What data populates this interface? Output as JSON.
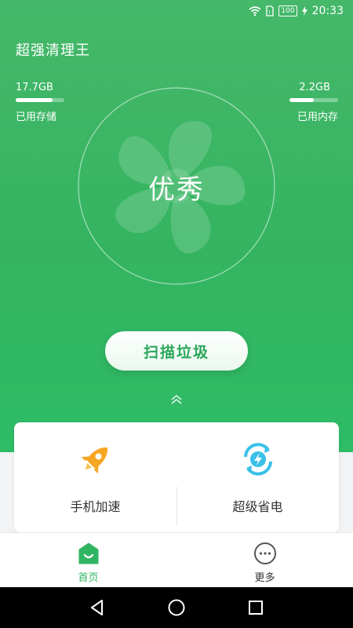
{
  "status_bar": {
    "time": "20:33",
    "battery": "100"
  },
  "app": {
    "title": "超强清理王"
  },
  "storage": {
    "value": "17.7GB",
    "label": "已用存储",
    "fill_fraction": 0.75
  },
  "memory": {
    "value": "2.2GB",
    "label": "已用内存",
    "fill_fraction": 0.5
  },
  "score": {
    "text": "优秀"
  },
  "actions": {
    "scan_label": "扫描垃圾"
  },
  "features": [
    {
      "label": "手机加速",
      "icon": "rocket-icon",
      "color": "#f5a623"
    },
    {
      "label": "超级省电",
      "icon": "battery-saver-icon",
      "color": "#39c0e8"
    }
  ],
  "tabs": [
    {
      "label": "首页",
      "icon": "home-icon",
      "active": true
    },
    {
      "label": "更多",
      "icon": "more-icon",
      "active": false
    }
  ],
  "colors": {
    "brand": "#34b461",
    "accent_text": "#2aa85b"
  }
}
